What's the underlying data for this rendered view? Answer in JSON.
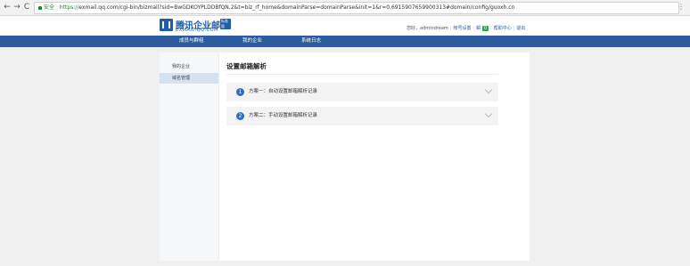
{
  "browser": {
    "back": "←",
    "forward": "→",
    "reload": "C",
    "secure_label": "安全",
    "url_protocol": "https://",
    "url_rest": "exmail.qq.com/cgi-bin/bizmail?sid=BwGDKOYPLDDBfQN,2&t=biz_rf_home&domainParse=domainParse&init=1&r=0.6915907659900313#domain/config/guoxh.cn",
    "menu": "⋮"
  },
  "logo": {
    "cn": "腾讯企业邮",
    "en": "EXMAIL.QQ.COM",
    "badge": "标准版"
  },
  "user": {
    "greeting": "您好，admindream",
    "account_settings": "帐号设置",
    "mail_icon": "邮",
    "mail_count": "0",
    "help": "帮助中心",
    "logout": "退出"
  },
  "mainnav": {
    "items": [
      "成员与群组",
      "我的企业",
      "系统日志"
    ]
  },
  "sidebar": {
    "items": [
      "我的企业",
      "域名管理"
    ]
  },
  "main": {
    "title": "设置邮箱解析",
    "plans": [
      {
        "num": "1",
        "label": "方案一：自动设置邮箱解析记录"
      },
      {
        "num": "2",
        "label": "方案二：手动设置邮箱解析记录"
      }
    ]
  }
}
